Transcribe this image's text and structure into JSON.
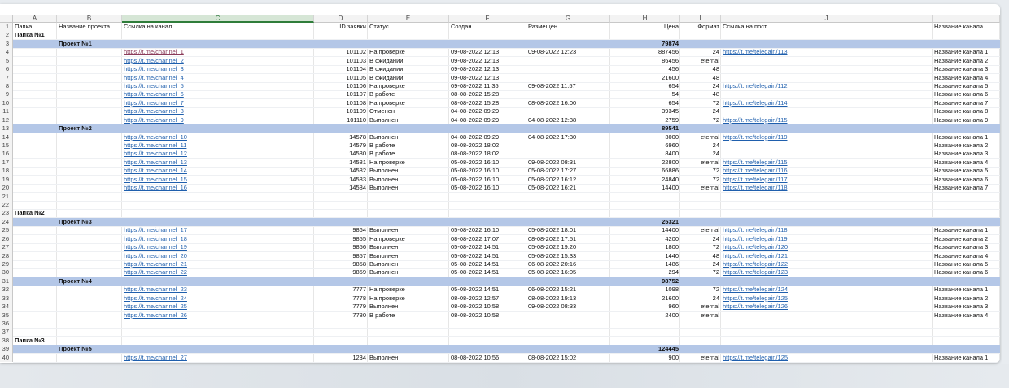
{
  "columns": [
    "A",
    "B",
    "C",
    "D",
    "E",
    "F",
    "G",
    "H",
    "I",
    "J"
  ],
  "header": {
    "row": "1",
    "A": "Папка",
    "B": "Название проекта",
    "C": "Ссылка на канал",
    "D": "ID заявки",
    "E": "Статус",
    "F": "Создан",
    "G": "Размещен",
    "H": "Цена",
    "I": "Формат",
    "J": "Ссылка на пост",
    "K": "Название канала"
  },
  "rows": [
    {
      "n": "2",
      "type": "folder",
      "A": "Папка №1"
    },
    {
      "n": "3",
      "type": "project",
      "B": "Проект №1",
      "H": "79874"
    },
    {
      "n": "4",
      "type": "data",
      "C": "https://t.me/channel_1",
      "D": "101102",
      "E": "На проверке",
      "F": "09-08-2022 12:13",
      "G": "09-08-2022 12:23",
      "H": "887456",
      "I": "24",
      "J": "https://t.me/telegain/113",
      "K": "Название канала 1",
      "first": true
    },
    {
      "n": "5",
      "type": "data",
      "C": "https://t.me/channel_2",
      "D": "101103",
      "E": "В ожидании",
      "F": "09-08-2022 12:13",
      "G": "",
      "H": "86456",
      "I": "eternal",
      "J": "",
      "K": "Название канала 2"
    },
    {
      "n": "6",
      "type": "data",
      "C": "https://t.me/channel_3",
      "D": "101104",
      "E": "В ожидании",
      "F": "09-08-2022 12:13",
      "G": "",
      "H": "456",
      "I": "48",
      "J": "",
      "K": "Название канала 3"
    },
    {
      "n": "7",
      "type": "data",
      "C": "https://t.me/channel_4",
      "D": "101105",
      "E": "В ожидании",
      "F": "09-08-2022 12:13",
      "G": "",
      "H": "21600",
      "I": "48",
      "J": "",
      "K": "Название канала 4"
    },
    {
      "n": "8",
      "type": "data",
      "C": "https://t.me/channel_5",
      "D": "101106",
      "E": "На проверке",
      "F": "09-08-2022 11:35",
      "G": "09-08-2022 11:57",
      "H": "654",
      "I": "24",
      "J": "https://t.me/telegain/112",
      "K": "Название канала 5"
    },
    {
      "n": "9",
      "type": "data",
      "C": "https://t.me/channel_6",
      "D": "101107",
      "E": "В работе",
      "F": "08-08-2022 15:28",
      "G": "",
      "H": "54",
      "I": "48",
      "J": "",
      "K": "Название канала 6"
    },
    {
      "n": "10",
      "type": "data",
      "C": "https://t.me/channel_7",
      "D": "101108",
      "E": "На проверке",
      "F": "08-08-2022 15:28",
      "G": "08-08-2022 16:00",
      "H": "654",
      "I": "72",
      "J": "https://t.me/telegain/114",
      "K": "Название канала 7"
    },
    {
      "n": "11",
      "type": "data",
      "C": "https://t.me/channel_8",
      "D": "101109",
      "E": "Отменен",
      "F": "04-08-2022 09:29",
      "G": "",
      "H": "39345",
      "I": "24",
      "J": "",
      "K": "Название канала 8"
    },
    {
      "n": "12",
      "type": "data",
      "C": "https://t.me/channel_9",
      "D": "101110",
      "E": "Выполнен",
      "F": "04-08-2022 09:29",
      "G": "04-08-2022 12:38",
      "H": "2759",
      "I": "72",
      "J": "https://t.me/telegain/115",
      "K": "Название канала 9"
    },
    {
      "n": "13",
      "type": "project",
      "B": "Проект №2",
      "H": "89541"
    },
    {
      "n": "14",
      "type": "data",
      "C": "https://t.me/channel_10",
      "D": "14578",
      "E": "Выполнен",
      "F": "04-08-2022 09:29",
      "G": "04-08-2022 17:30",
      "H": "3000",
      "I": "eternal",
      "J": "https://t.me/telegain/119",
      "K": "Название канала 1"
    },
    {
      "n": "15",
      "type": "data",
      "C": "https://t.me/channel_11",
      "D": "14579",
      "E": "В работе",
      "F": "08-08-2022 18:02",
      "G": "",
      "H": "6960",
      "I": "24",
      "J": "",
      "K": "Название канала 2"
    },
    {
      "n": "16",
      "type": "data",
      "C": "https://t.me/channel_12",
      "D": "14580",
      "E": "В работе",
      "F": "08-08-2022 18:02",
      "G": "",
      "H": "8400",
      "I": "24",
      "J": "",
      "K": "Название канала 3"
    },
    {
      "n": "17",
      "type": "data",
      "C": "https://t.me/channel_13",
      "D": "14581",
      "E": "На проверке",
      "F": "05-08-2022 16:10",
      "G": "09-08-2022 08:31",
      "H": "22800",
      "I": "eternal",
      "J": "https://t.me/telegain/115",
      "K": "Название канала 4"
    },
    {
      "n": "18",
      "type": "data",
      "C": "https://t.me/channel_14",
      "D": "14582",
      "E": "Выполнен",
      "F": "05-08-2022 16:10",
      "G": "05-08-2022 17:27",
      "H": "66886",
      "I": "72",
      "J": "https://t.me/telegain/116",
      "K": "Название канала 5"
    },
    {
      "n": "19",
      "type": "data",
      "C": "https://t.me/channel_15",
      "D": "14583",
      "E": "Выполнен",
      "F": "05-08-2022 16:10",
      "G": "05-08-2022 16:12",
      "H": "24840",
      "I": "72",
      "J": "https://t.me/telegain/117",
      "K": "Название канала 6"
    },
    {
      "n": "20",
      "type": "data",
      "C": "https://t.me/channel_16",
      "D": "14584",
      "E": "Выполнен",
      "F": "05-08-2022 16:10",
      "G": "05-08-2022 16:21",
      "H": "14400",
      "I": "eternal",
      "J": "https://t.me/telegain/118",
      "K": "Название канала 7"
    },
    {
      "n": "21",
      "type": "empty"
    },
    {
      "n": "22",
      "type": "empty"
    },
    {
      "n": "23",
      "type": "folder",
      "A": "Папка №2"
    },
    {
      "n": "24",
      "type": "project",
      "B": "Проект №3",
      "H": "25321"
    },
    {
      "n": "25",
      "type": "data",
      "C": "https://t.me/channel_17",
      "D": "9864",
      "E": "Выполнен",
      "F": "05-08-2022 16:10",
      "G": "05-08-2022 18:01",
      "H": "14400",
      "I": "eternal",
      "J": "https://t.me/telegain/118",
      "K": "Название канала 1"
    },
    {
      "n": "26",
      "type": "data",
      "C": "https://t.me/channel_18",
      "D": "9855",
      "E": "На проверке",
      "F": "08-08-2022 17:07",
      "G": "08-08-2022 17:51",
      "H": "4200",
      "I": "24",
      "J": "https://t.me/telegain/119",
      "K": "Название канала 2"
    },
    {
      "n": "27",
      "type": "data",
      "C": "https://t.me/channel_19",
      "D": "9856",
      "E": "Выполнен",
      "F": "05-08-2022 14:51",
      "G": "05-08-2022 19:20",
      "H": "1800",
      "I": "72",
      "J": "https://t.me/telegain/120",
      "K": "Название канала 3"
    },
    {
      "n": "28",
      "type": "data",
      "C": "https://t.me/channel_20",
      "D": "9857",
      "E": "Выполнен",
      "F": "05-08-2022 14:51",
      "G": "05-08-2022 15:33",
      "H": "1440",
      "I": "48",
      "J": "https://t.me/telegain/121",
      "K": "Название канала 4"
    },
    {
      "n": "29",
      "type": "data",
      "C": "https://t.me/channel_21",
      "D": "9858",
      "E": "Выполнен",
      "F": "05-08-2022 14:51",
      "G": "06-08-2022 20:16",
      "H": "1486",
      "I": "24",
      "J": "https://t.me/telegain/122",
      "K": "Название канала 5"
    },
    {
      "n": "30",
      "type": "data",
      "C": "https://t.me/channel_22",
      "D": "9859",
      "E": "Выполнен",
      "F": "05-08-2022 14:51",
      "G": "05-08-2022 16:05",
      "H": "294",
      "I": "72",
      "J": "https://t.me/telegain/123",
      "K": "Название канала 6"
    },
    {
      "n": "31",
      "type": "project",
      "B": "Проект №4",
      "H": "98752"
    },
    {
      "n": "32",
      "type": "data",
      "C": "https://t.me/channel_23",
      "D": "7777",
      "E": "На проверке",
      "F": "05-08-2022 14:51",
      "G": "06-08-2022 15:21",
      "H": "1098",
      "I": "72",
      "J": "https://t.me/telegain/124",
      "K": "Название канала 1"
    },
    {
      "n": "33",
      "type": "data",
      "C": "https://t.me/channel_24",
      "D": "7778",
      "E": "На проверке",
      "F": "08-08-2022 12:57",
      "G": "08-08-2022 19:13",
      "H": "21600",
      "I": "24",
      "J": "https://t.me/telegain/125",
      "K": "Название канала 2"
    },
    {
      "n": "34",
      "type": "data",
      "C": "https://t.me/channel_25",
      "D": "7779",
      "E": "Выполнен",
      "F": "08-08-2022 10:58",
      "G": "09-08-2022 08:33",
      "H": "960",
      "I": "eternal",
      "J": "https://t.me/telegain/126",
      "K": "Название канала 3"
    },
    {
      "n": "35",
      "type": "data",
      "C": "https://t.me/channel_26",
      "D": "7780",
      "E": "В работе",
      "F": "08-08-2022 10:58",
      "G": "",
      "H": "2400",
      "I": "eternal",
      "J": "",
      "K": "Название канала 4"
    },
    {
      "n": "36",
      "type": "empty"
    },
    {
      "n": "37",
      "type": "empty"
    },
    {
      "n": "38",
      "type": "folder",
      "A": "Папка №3"
    },
    {
      "n": "39",
      "type": "project",
      "B": "Проект №5",
      "H": "124445"
    },
    {
      "n": "40",
      "type": "data",
      "C": "https://t.me/channel_27",
      "D": "1234",
      "E": "Выполнен",
      "F": "08-08-2022 10:56",
      "G": "08-08-2022 15:02",
      "H": "900",
      "I": "eternal",
      "J": "https://t.me/telegain/125",
      "K": "Название канала 1"
    }
  ],
  "colors": {
    "project_row": "#b4c7e7",
    "link": "#1f5fad",
    "selected_column_header": "#2f7d3a"
  }
}
